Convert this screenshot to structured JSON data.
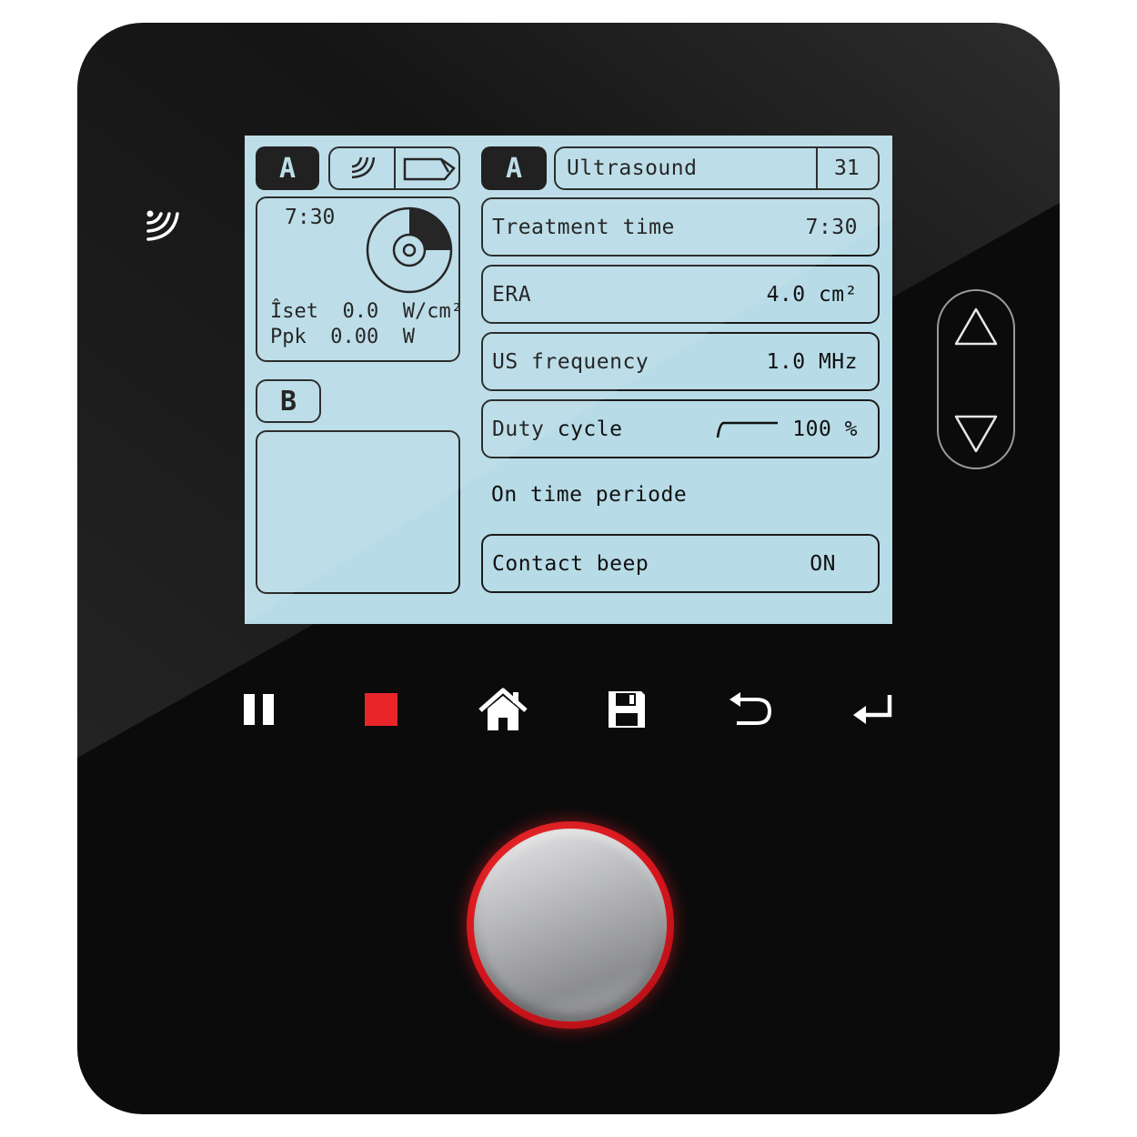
{
  "header": {
    "channel_a_label": "A",
    "program_title": "Ultrasound",
    "program_number": "31"
  },
  "channel_a": {
    "time": "7:30",
    "iset_label": "Îset",
    "iset_value": "0.0",
    "iset_unit": "W/cm²",
    "ppk_label": "Ppk",
    "ppk_value": "0.00",
    "ppk_unit": "W",
    "progress_fraction": 0.25
  },
  "channel_b": {
    "label": "B"
  },
  "settings": [
    {
      "label": "Treatment time",
      "value": "7:30"
    },
    {
      "label": "ERA",
      "value": "4.0 cm²"
    },
    {
      "label": "US frequency",
      "value": "1.0 MHz"
    },
    {
      "label": "Duty cycle",
      "value": "100 %"
    }
  ],
  "on_time_label": "On time periode",
  "contact_beep": {
    "label": "Contact beep",
    "value": "ON"
  },
  "icons": {
    "side": "ultrasound-waves-icon",
    "controls": [
      "pause-icon",
      "stop-icon",
      "home-icon",
      "save-icon",
      "back-icon",
      "enter-icon"
    ],
    "arrows": [
      "up-arrow-icon",
      "down-arrow-icon"
    ]
  },
  "colors": {
    "screen": "#b7dbe7",
    "stop": "#e8262a",
    "knob_ring": "#d4151c",
    "body": "#0b0b0c"
  }
}
